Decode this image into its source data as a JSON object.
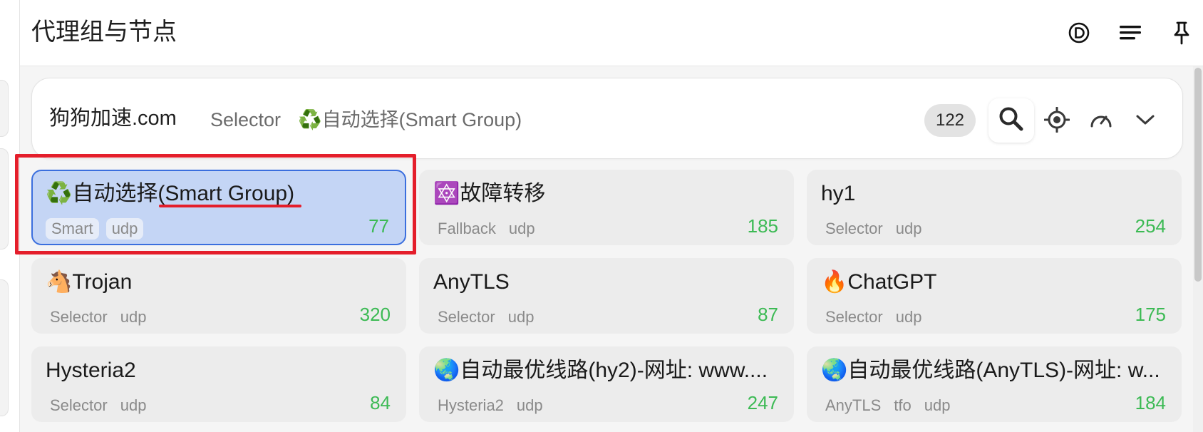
{
  "header": {
    "title": "代理组与节点",
    "icons": [
      "d-circle-icon",
      "menu-lines-icon",
      "pin-icon"
    ]
  },
  "group": {
    "name": "狗狗加速.com",
    "type": "Selector",
    "now_icon": "♻️",
    "now": "自动选择(Smart Group)",
    "count": "122",
    "icons": [
      "search-icon",
      "locate-icon",
      "speed-test-icon",
      "chevron-down-icon"
    ]
  },
  "proxies": [
    {
      "icon": "♻️",
      "name": "自动选择(Smart Group)",
      "tags": [
        "Smart",
        "udp"
      ],
      "delay": "77",
      "selected": true
    },
    {
      "icon": "🔯",
      "name": "故障转移",
      "tags": [
        "Fallback",
        "udp"
      ],
      "delay": "185"
    },
    {
      "icon": "",
      "name": "hy1",
      "tags": [
        "Selector",
        "udp"
      ],
      "delay": "254"
    },
    {
      "icon": "🐴",
      "name": "Trojan",
      "tags": [
        "Selector",
        "udp"
      ],
      "delay": "320"
    },
    {
      "icon": "",
      "name": "AnyTLS",
      "tags": [
        "Selector",
        "udp"
      ],
      "delay": "87"
    },
    {
      "icon": "🔥",
      "name": "ChatGPT",
      "tags": [
        "Selector",
        "udp"
      ],
      "delay": "175"
    },
    {
      "icon": "",
      "name": "Hysteria2",
      "tags": [
        "Selector",
        "udp"
      ],
      "delay": "84"
    },
    {
      "icon": "🌏",
      "name": "自动最优线路(hy2)-网址: www....",
      "tags": [
        "Hysteria2",
        "udp"
      ],
      "delay": "247"
    },
    {
      "icon": "🌏",
      "name": "自动最优线路(AnyTLS)-网址: w...",
      "tags": [
        "AnyTLS",
        "tfo",
        "udp"
      ],
      "delay": "184"
    }
  ],
  "colors": {
    "selected_bg": "#c4d5f5",
    "selected_border": "#3b6fde",
    "delay_green": "#3cba54",
    "annotation_red": "#e41e2b"
  }
}
